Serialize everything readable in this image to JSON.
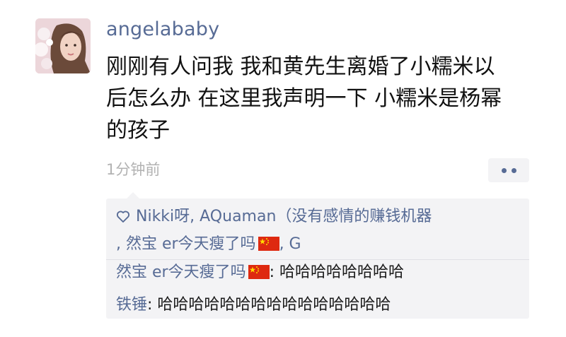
{
  "post": {
    "author": "angelababy",
    "lines": [
      "刚刚有人问我 我和黄先生离婚了小糯米以",
      "后怎么办 在这里我声明一下 小糯米是杨幂",
      "的孩子"
    ],
    "time": "1分钟前"
  },
  "likes": {
    "line1": "Nikki呀, AQuaman（没有感情的赚钱机器",
    "line2_a": ", 然宝 er今天瘦了吗",
    "line2_b": ", G"
  },
  "comments": [
    {
      "name": "然宝 er今天瘦了吗",
      "separator": ": ",
      "text": "哈哈哈哈哈哈哈哈",
      "flag": true
    },
    {
      "name": "铁锤",
      "separator": ": ",
      "text": "哈哈哈哈哈哈哈哈哈哈哈哈哈哈哈",
      "flag": false
    }
  ],
  "icons": {
    "avatar": "avatar-photo",
    "more": "more-dots-icon",
    "like": "heart-outline-icon",
    "flag": "china-flag-icon"
  },
  "colors": {
    "name_link": "#576b95",
    "timestamp": "#b2b2b2",
    "panel_bg": "#f3f3f5",
    "flag_red": "#de2910",
    "flag_star": "#ffde00"
  }
}
